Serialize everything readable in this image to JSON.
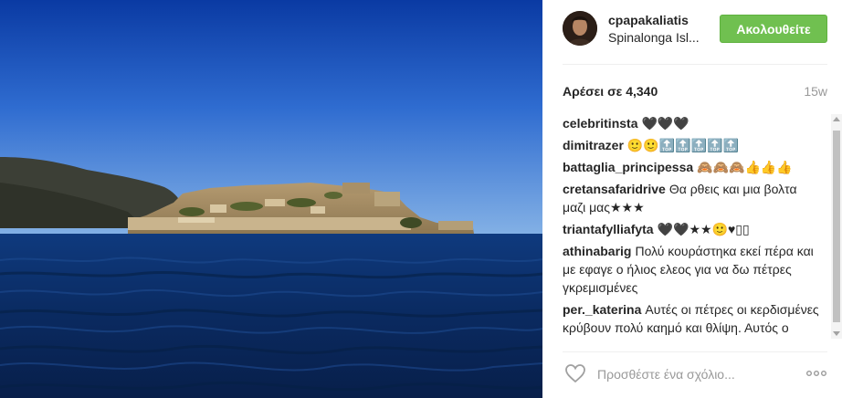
{
  "post": {
    "author": "cpapakaliatis",
    "location": "Spinalonga Isl...",
    "follow_label": "Ακολουθείτε",
    "likes": "Αρέσει σε 4,340",
    "time": "15w"
  },
  "comments": [
    {
      "user": "celebritinsta",
      "text": "🖤🖤🖤"
    },
    {
      "user": "dimitrazer",
      "text": "🙂🙂🔝🔝🔝🔝🔝"
    },
    {
      "user": "battaglia_principessa",
      "text": "🙈🙈🙈👍👍👍"
    },
    {
      "user": "cretansafaridrive",
      "text": "Θα ρθεις και μια βολτα μαζι μας★★★"
    },
    {
      "user": "triantafylliafyta",
      "text": "🖤🖤★★🙂♥▯▯"
    },
    {
      "user": "athinabarig",
      "text": "Πολύ κουράστηκα εκεί πέρα και με εφαγε ο ήλιος ελεος για να δω πέτρες γκρεμισμένες"
    },
    {
      "user": "per._katerina",
      "text": "Αυτές οι πέτρες οι κερδισμένες κρύβουν πολύ καημό και θλίψη. Αυτός ο τόπος έχει πολλή ιστορία. Π"
    }
  ],
  "composer": {
    "placeholder": "Προσθέστε ένα σχόλιο..."
  },
  "icons": {
    "like": "heart-outline-icon",
    "more": "more-options-icon"
  },
  "colors": {
    "follow": "#70c050",
    "sky_top": "#0d3fa6",
    "sea": "#0b2c63"
  }
}
